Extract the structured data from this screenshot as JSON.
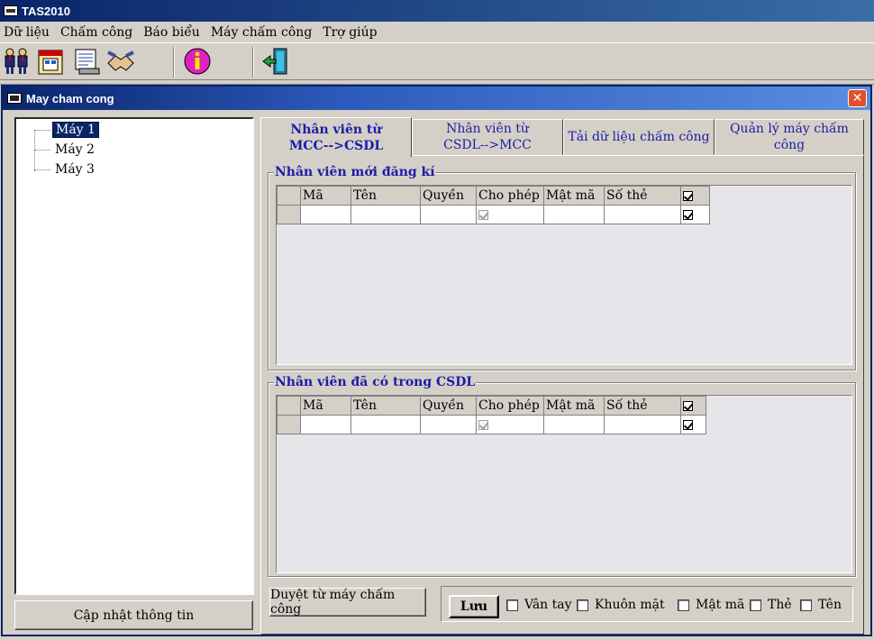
{
  "app": {
    "title": "TAS2010"
  },
  "menu": [
    "Dữ liệu",
    "Chấm công",
    "Báo biểu",
    "Máy chấm công",
    "Trợ giúp"
  ],
  "toolbar": {
    "buttons": [
      "employees-icon",
      "calendar-icon",
      "report-icon",
      "handshake-icon",
      "info-icon",
      "exit-icon"
    ]
  },
  "window": {
    "title": "May cham cong"
  },
  "tree": {
    "items": [
      "Máy 1",
      "Máy 2",
      "Máy 3"
    ],
    "selected": "Máy 1"
  },
  "update_button": "Cập nhật thông tin",
  "tabs": [
    {
      "line1": "Nhân viên từ",
      "line2": "MCC-->CSDL",
      "active": true
    },
    {
      "line1": "Nhân viên từ",
      "line2": "CSDL-->MCC",
      "active": false
    },
    {
      "line1": "Tải dữ liệu chấm công",
      "line2": "",
      "active": false
    },
    {
      "line1": "Quản lý máy chấm công",
      "line2": "",
      "active": false
    }
  ],
  "group_new": {
    "title": "Nhân viên mới đăng kí",
    "columns": [
      "Mã",
      "Tên",
      "Quyền",
      "Cho phép",
      "Mật mã",
      "Số thẻ"
    ]
  },
  "group_existing": {
    "title": "Nhân viên đã có trong CSDL",
    "columns": [
      "Mã",
      "Tên",
      "Quyền",
      "Cho phép",
      "Mật mã",
      "Số thẻ"
    ]
  },
  "bottom": {
    "browse_button": "Duyệt từ máy chấm công",
    "save_button": "Lưu",
    "options": [
      "Vân tay",
      "Khuôn mặt",
      "Mật mã",
      "Thẻ",
      "Tên"
    ]
  }
}
